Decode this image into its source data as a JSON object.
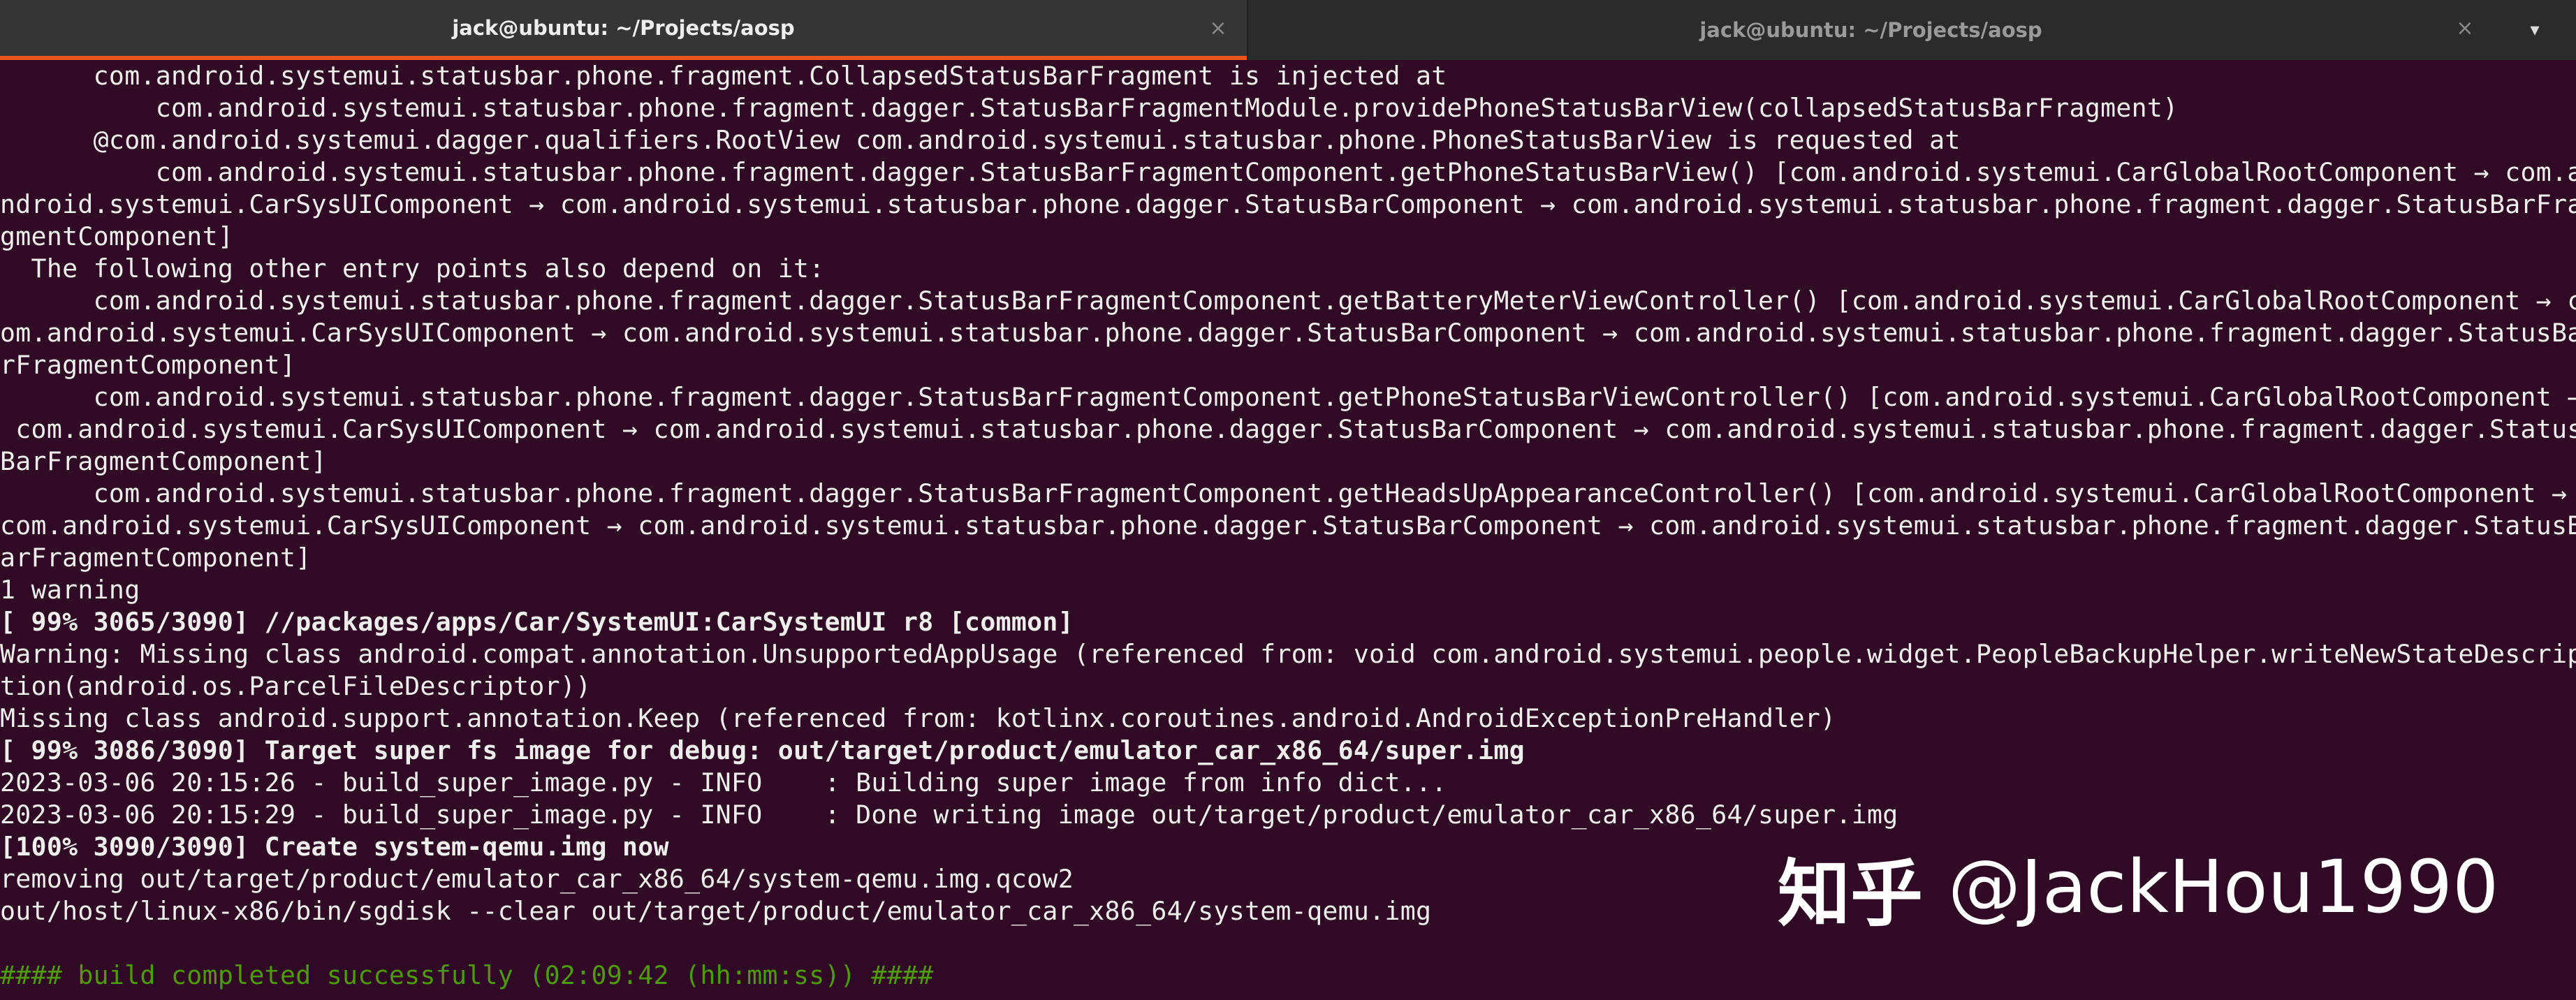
{
  "tabs": [
    {
      "title": "jack@ubuntu: ~/Projects/aosp",
      "active": true,
      "close_glyph": "×"
    },
    {
      "title": "jack@ubuntu: ~/Projects/aosp",
      "active": false,
      "close_glyph": "×"
    }
  ],
  "menu": {
    "glyph": "▾",
    "icon": "chevron-down-icon"
  },
  "colors": {
    "background": "#300a24",
    "text": "#eeeeec",
    "success": "#4e9a06",
    "tab_accent": "#e95420"
  },
  "terminal": {
    "lines": [
      {
        "text": "      com.android.systemui.statusbar.phone.fragment.CollapsedStatusBarFragment is injected at",
        "style": ""
      },
      {
        "text": "          com.android.systemui.statusbar.phone.fragment.dagger.StatusBarFragmentModule.providePhoneStatusBarView(collapsedStatusBarFragment)",
        "style": ""
      },
      {
        "text": "      @com.android.systemui.dagger.qualifiers.RootView com.android.systemui.statusbar.phone.PhoneStatusBarView is requested at",
        "style": ""
      },
      {
        "text": "          com.android.systemui.statusbar.phone.fragment.dagger.StatusBarFragmentComponent.getPhoneStatusBarView() [com.android.systemui.CarGlobalRootComponent → com.a",
        "style": ""
      },
      {
        "text": "ndroid.systemui.CarSysUIComponent → com.android.systemui.statusbar.phone.dagger.StatusBarComponent → com.android.systemui.statusbar.phone.fragment.dagger.StatusBarFra",
        "style": ""
      },
      {
        "text": "gmentComponent]",
        "style": ""
      },
      {
        "text": "  The following other entry points also depend on it:",
        "style": ""
      },
      {
        "text": "      com.android.systemui.statusbar.phone.fragment.dagger.StatusBarFragmentComponent.getBatteryMeterViewController() [com.android.systemui.CarGlobalRootComponent → c",
        "style": ""
      },
      {
        "text": "om.android.systemui.CarSysUIComponent → com.android.systemui.statusbar.phone.dagger.StatusBarComponent → com.android.systemui.statusbar.phone.fragment.dagger.StatusBa",
        "style": ""
      },
      {
        "text": "rFragmentComponent]",
        "style": ""
      },
      {
        "text": "      com.android.systemui.statusbar.phone.fragment.dagger.StatusBarFragmentComponent.getPhoneStatusBarViewController() [com.android.systemui.CarGlobalRootComponent →",
        "style": ""
      },
      {
        "text": " com.android.systemui.CarSysUIComponent → com.android.systemui.statusbar.phone.dagger.StatusBarComponent → com.android.systemui.statusbar.phone.fragment.dagger.Status",
        "style": ""
      },
      {
        "text": "BarFragmentComponent]",
        "style": ""
      },
      {
        "text": "      com.android.systemui.statusbar.phone.fragment.dagger.StatusBarFragmentComponent.getHeadsUpAppearanceController() [com.android.systemui.CarGlobalRootComponent →",
        "style": ""
      },
      {
        "text": "com.android.systemui.CarSysUIComponent → com.android.systemui.statusbar.phone.dagger.StatusBarComponent → com.android.systemui.statusbar.phone.fragment.dagger.StatusB",
        "style": ""
      },
      {
        "text": "arFragmentComponent]",
        "style": ""
      },
      {
        "text": "1 warning",
        "style": ""
      },
      {
        "text": "[ 99% 3065/3090] //packages/apps/Car/SystemUI:CarSystemUI r8 [common]",
        "style": "bold"
      },
      {
        "text": "Warning: Missing class android.compat.annotation.UnsupportedAppUsage (referenced from: void com.android.systemui.people.widget.PeopleBackupHelper.writeNewStateDescrip",
        "style": ""
      },
      {
        "text": "tion(android.os.ParcelFileDescriptor))",
        "style": ""
      },
      {
        "text": "Missing class android.support.annotation.Keep (referenced from: kotlinx.coroutines.android.AndroidExceptionPreHandler)",
        "style": ""
      },
      {
        "text": "[ 99% 3086/3090] Target super fs image for debug: out/target/product/emulator_car_x86_64/super.img",
        "style": "bold"
      },
      {
        "text": "2023-03-06 20:15:26 - build_super_image.py - INFO    : Building super image from info dict...",
        "style": ""
      },
      {
        "text": "2023-03-06 20:15:29 - build_super_image.py - INFO    : Done writing image out/target/product/emulator_car_x86_64/super.img",
        "style": ""
      },
      {
        "text": "[100% 3090/3090] Create system-qemu.img now",
        "style": "bold"
      },
      {
        "text": "removing out/target/product/emulator_car_x86_64/system-qemu.img.qcow2",
        "style": ""
      },
      {
        "text": "out/host/linux-x86/bin/sgdisk --clear out/target/product/emulator_car_x86_64/system-qemu.img",
        "style": ""
      },
      {
        "text": "",
        "style": ""
      },
      {
        "text": "#### build completed successfully (02:09:42 (hh:mm:ss)) ####",
        "style": "green"
      }
    ]
  },
  "watermark": {
    "logo": "知乎",
    "handle": "@JackHou1990"
  }
}
